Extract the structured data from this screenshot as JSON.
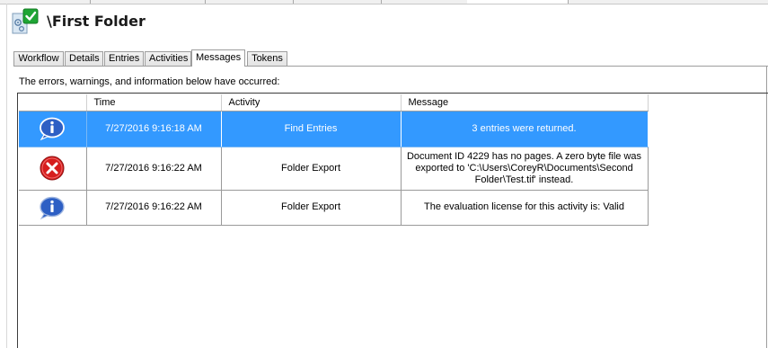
{
  "page": {
    "title": "\\First Folder"
  },
  "tabs": [
    {
      "label": "Workflow",
      "active": false
    },
    {
      "label": "Details",
      "active": false
    },
    {
      "label": "Entries",
      "active": false
    },
    {
      "label": "Activities",
      "active": false
    },
    {
      "label": "Messages",
      "active": true
    },
    {
      "label": "Tokens",
      "active": false
    }
  ],
  "intro_text": "The errors, warnings, and information below have occurred:",
  "grid": {
    "columns": [
      "",
      "Time",
      "Activity",
      "Message"
    ],
    "rows": [
      {
        "icon": "info-icon",
        "time": "7/27/2016 9:16:18 AM",
        "activity": "Find Entries",
        "message": "3 entries were returned.",
        "selected": true
      },
      {
        "icon": "error-icon",
        "time": "7/27/2016 9:16:22 AM",
        "activity": "Folder Export",
        "message": "Document ID 4229 has no pages.  A zero byte file was exported to 'C:\\Users\\CoreyR\\Documents\\Second Folder\\Test.tif' instead.",
        "selected": false
      },
      {
        "icon": "info-icon",
        "time": "7/27/2016 9:16:22 AM",
        "activity": "Folder Export",
        "message": "The evaluation license for this activity is: Valid",
        "selected": false
      }
    ]
  },
  "colors": {
    "selection": "#3399ff",
    "error": "#d61e1e",
    "info": "#2d5fc4",
    "success_check": "#1ea534"
  }
}
